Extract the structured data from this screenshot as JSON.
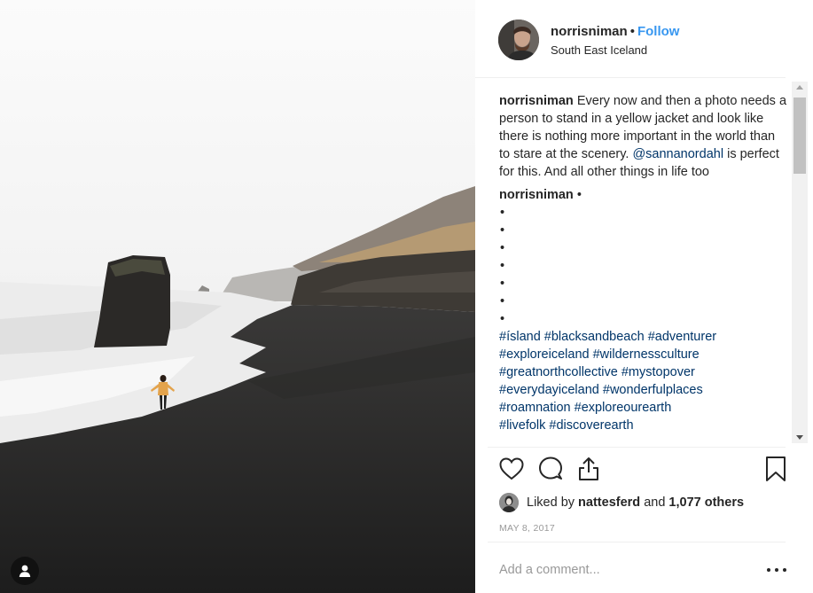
{
  "post": {
    "username": "norrisniman",
    "follow_label": "Follow",
    "separator": "•",
    "location": "South East Iceland"
  },
  "caption": {
    "username": "norrisniman",
    "text_before_mention": "Every now and then a photo needs a person to stand in a yellow jacket and look like there is nothing more important in the world than to stare at the scenery.",
    "mention": "@sannanordahl",
    "text_after_mention": "is perfect for this. And all other things in life too"
  },
  "comment": {
    "username": "norrisniman",
    "suffix": "•",
    "bullets": [
      "•",
      "•",
      "•",
      "•",
      "•",
      "•",
      "•"
    ],
    "hashtags": [
      "#ísland",
      "#blacksandbeach",
      "#adventurer",
      "#exploreiceland",
      "#wildernessculture",
      "#greatnorthcollective",
      "#mystopover",
      "#everydayiceland",
      "#wonderfulplaces",
      "#roamnation",
      "#exploreourearth",
      "#livefolk",
      "#discoverearth"
    ]
  },
  "likes": {
    "prefix": "Liked by",
    "liker": "nattesferd",
    "conjunction": "and",
    "others": "1,077 others"
  },
  "date": "MAY 8, 2017",
  "comment_box": {
    "placeholder": "Add a comment..."
  },
  "icons": {
    "like": "heart-icon",
    "comment": "speech-bubble-icon",
    "share": "share-icon",
    "save": "bookmark-icon",
    "user_tags": "user-silhouette-icon",
    "more": "ellipsis-icon"
  },
  "colors": {
    "link_blue": "#3897f0",
    "hashtag_navy": "#003569",
    "text": "#262626",
    "muted": "#999999"
  }
}
